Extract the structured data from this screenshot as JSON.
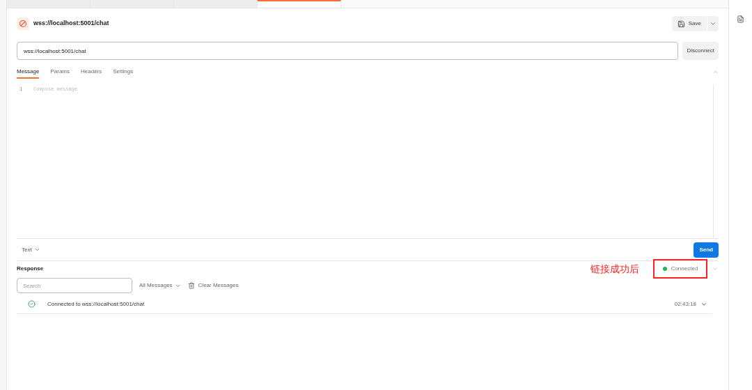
{
  "open_tabs": [
    {
      "selected": false
    },
    {
      "selected": false
    },
    {
      "selected": false
    },
    {
      "selected": true
    }
  ],
  "request": {
    "title": "wss://localhost:5001/chat",
    "save_label": "Save",
    "url": "wss://localhost:5001/chat",
    "connect_button": "Disconnect"
  },
  "tabs": [
    {
      "label": "Message",
      "selected": true
    },
    {
      "label": "Params",
      "selected": false
    },
    {
      "label": "Headers",
      "selected": false
    },
    {
      "label": "Settings",
      "selected": false
    }
  ],
  "editor": {
    "line_number": "1",
    "placeholder": "Compose message"
  },
  "format": "Text",
  "send_label": "Send",
  "response": {
    "title": "Response",
    "annotation": "链接成功后",
    "status": "Connected",
    "connected": true,
    "search_placeholder": "Search",
    "filter": "All Messages",
    "clear": "Clear Messages",
    "messages": [
      {
        "text": "Connected to wss://localhost:5001/chat",
        "time": "02:43:18",
        "kind": "connected"
      }
    ]
  }
}
